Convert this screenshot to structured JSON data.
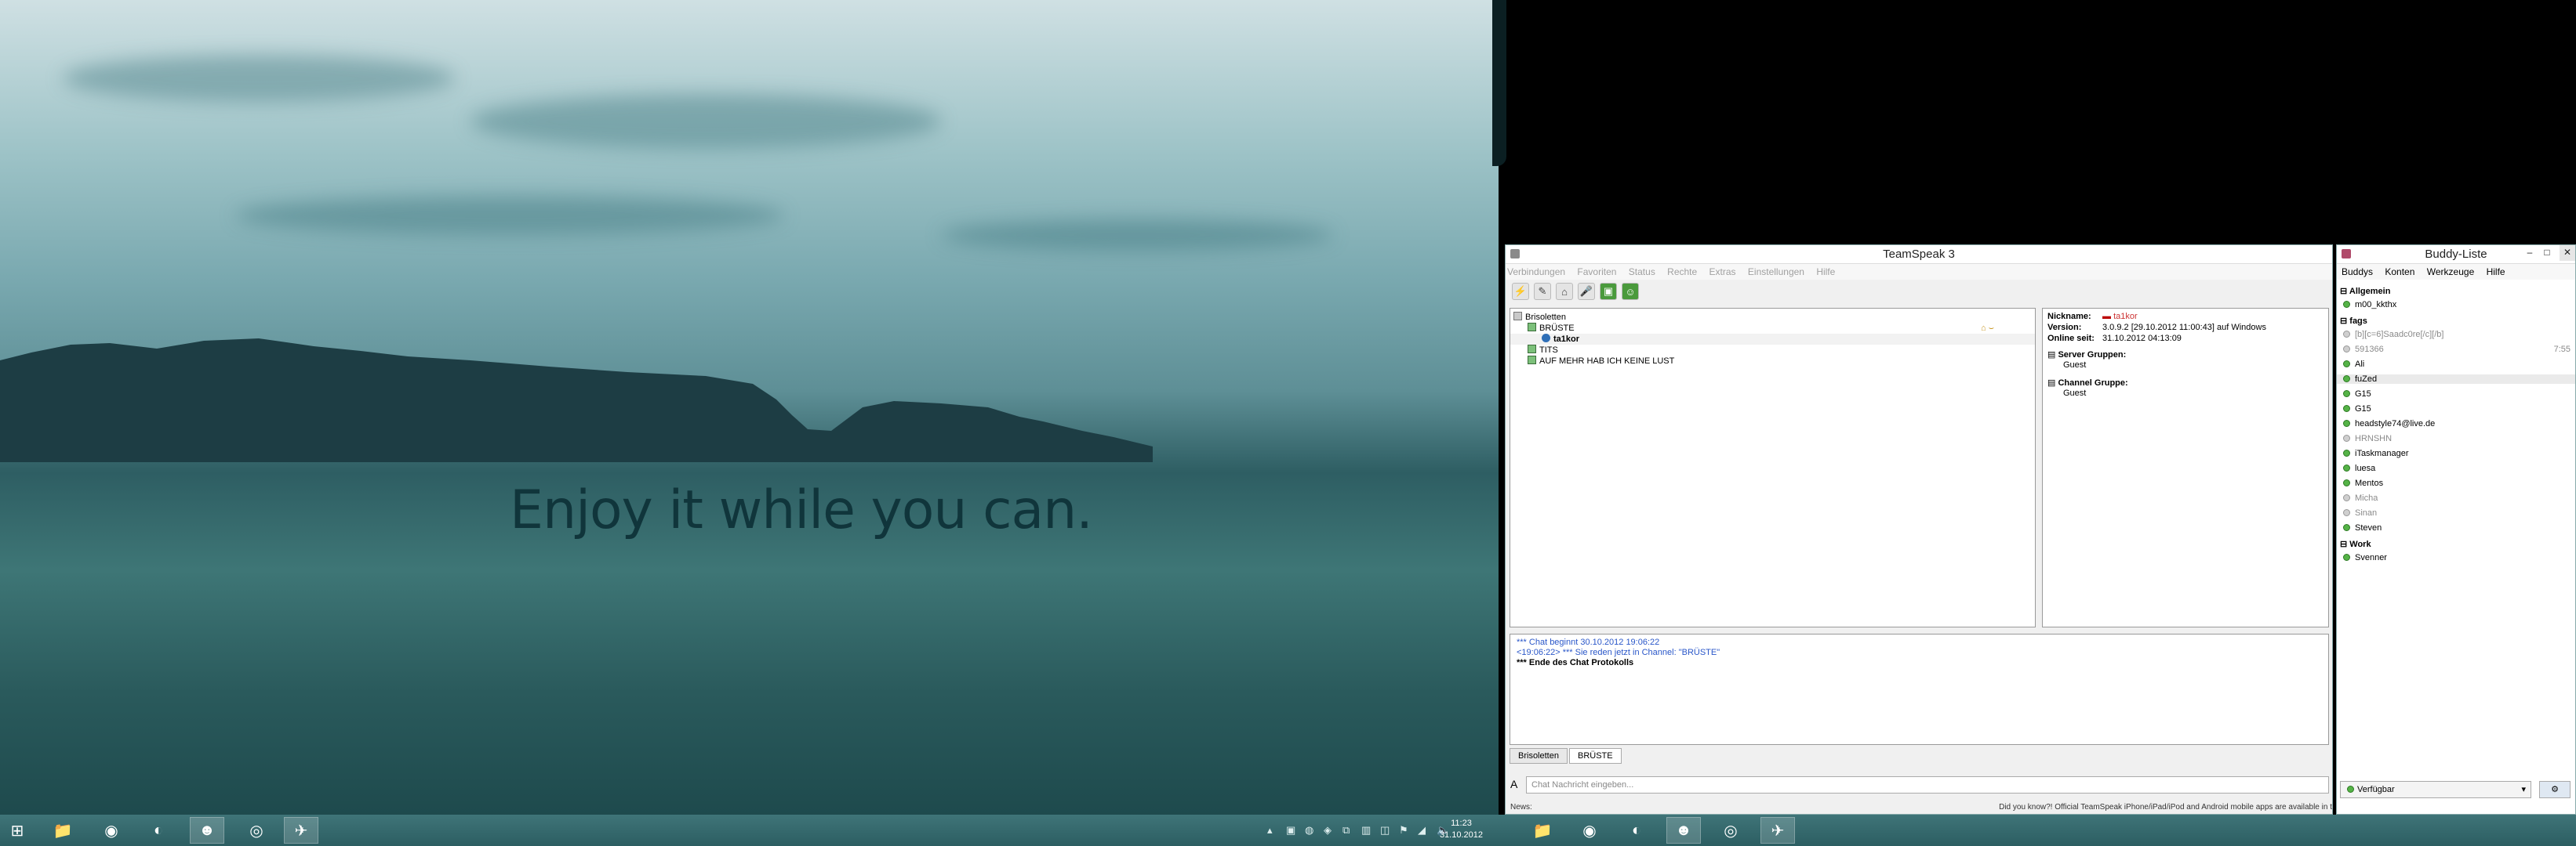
{
  "desktop": {
    "slogan": "Enjoy it while you can."
  },
  "teamspeak": {
    "title": "TeamSpeak 3",
    "menu": [
      "Verbindungen",
      "Favoriten",
      "Status",
      "Rechte",
      "Extras",
      "Einstellungen",
      "Hilfe"
    ],
    "tree": {
      "server": "Brisoletten",
      "channels": [
        {
          "name": "BRÜSTE",
          "users": [
            "ta1kor"
          ]
        },
        {
          "name": "TITS",
          "users": []
        },
        {
          "name": "AUF MEHR HAB ICH KEINE LUST",
          "users": []
        }
      ]
    },
    "info": {
      "nickname_label": "Nickname:",
      "nickname": "ta1kor",
      "version_label": "Version:",
      "version": "3.0.9.2 [29.10.2012 11:00:43] auf Windows",
      "online_label": "Online seit:",
      "online": "31.10.2012 04:13:09",
      "server_groups_label": "Server Gruppen:",
      "server_group": "Guest",
      "channel_group_label": "Channel Gruppe:",
      "channel_group": "Guest"
    },
    "chat_log": [
      "*** Chat beginnt 30.10.2012 19:06:22",
      "<19:06:22> *** Sie reden jetzt in Channel: \"BRÜSTE\"",
      "*** Ende des Chat Protokolls"
    ],
    "tabs": [
      "Brisoletten",
      "BRÜSTE"
    ],
    "chat_input_placeholder": "Chat Nachricht eingeben...",
    "news_label": "News:",
    "news_ticker": "Did you know?! Official TeamSpeak iPhone/iPad/iPod and Android mobile apps are available in t"
  },
  "buddylist": {
    "title": "Buddy-Liste",
    "menu": [
      "Buddys",
      "Konten",
      "Werkzeuge",
      "Hilfe"
    ],
    "groups": [
      {
        "name": "Allgemein",
        "buddies": [
          {
            "name": "m00_kkthx",
            "online": true
          }
        ]
      },
      {
        "name": "fags",
        "buddies": [
          {
            "name": "[b][c=6]Saadc0re[/c][/b]",
            "online": false
          },
          {
            "name": "591366",
            "online": false,
            "extra": "7:55"
          },
          {
            "name": "Ali",
            "online": true
          },
          {
            "name": "fuZed",
            "online": true
          },
          {
            "name": "G15",
            "online": true
          },
          {
            "name": "G15",
            "online": true
          },
          {
            "name": "headstyle74@live.de",
            "online": true
          },
          {
            "name": "HRNSHN",
            "online": false
          },
          {
            "name": "iTaskmanager",
            "online": true
          },
          {
            "name": "luesa",
            "online": true
          },
          {
            "name": "Mentos",
            "online": true
          },
          {
            "name": "Micha",
            "online": false
          },
          {
            "name": "Sinan",
            "online": false
          },
          {
            "name": "Steven",
            "online": true
          }
        ]
      },
      {
        "name": "Work",
        "buddies": [
          {
            "name": "Svenner",
            "online": true
          }
        ]
      }
    ],
    "status": "Verfügbar"
  },
  "taskbar": {
    "time": "11:23",
    "date": "31.10.2012"
  }
}
